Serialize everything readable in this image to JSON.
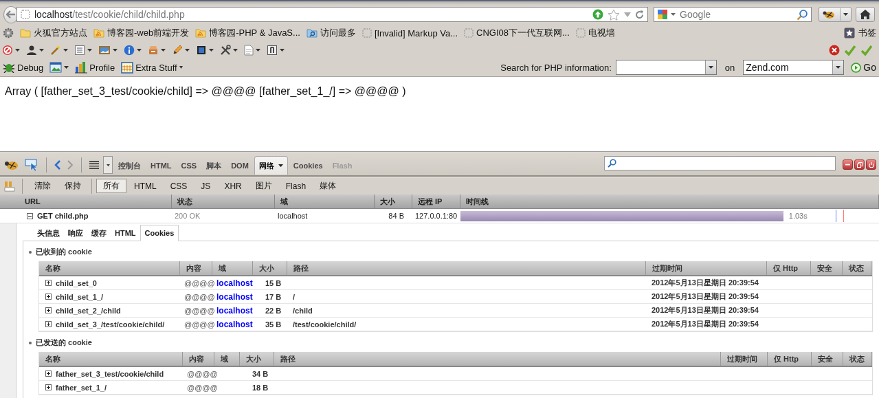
{
  "navbar": {
    "url_host": "localhost",
    "url_path": "/test/cookie/child/child.php",
    "search_placeholder": "Google"
  },
  "bookmarks": [
    {
      "kind": "folder",
      "label": "火狐官方站点"
    },
    {
      "kind": "feed",
      "label": "博客园-web前端开发"
    },
    {
      "kind": "feed",
      "label": "博客园-PHP & JavaS..."
    },
    {
      "kind": "smart",
      "label": "访问最多"
    },
    {
      "kind": "blank",
      "label": "[Invalid] Markup Va..."
    },
    {
      "kind": "blank",
      "label": "CNGI08下一代互联网..."
    },
    {
      "kind": "blank",
      "label": "电视墙"
    }
  ],
  "bookmarks_menu": "书签",
  "firebug_bar": {
    "debug": "Debug",
    "profile": "Profile",
    "extra": "Extra Stuff",
    "search_label": "Search for PHP information:",
    "on": "on",
    "site": "Zend.com",
    "go": "Go"
  },
  "page": {
    "text": "Array ( [father_set_3_test/cookie/child] => @@@@ [father_set_1_/] => @@@@ )"
  },
  "firebug": {
    "tabs": [
      {
        "label": "控制台",
        "selected": false,
        "disabled": false
      },
      {
        "label": "HTML",
        "selected": false,
        "disabled": false
      },
      {
        "label": "CSS",
        "selected": false,
        "disabled": false
      },
      {
        "label": "脚本",
        "selected": false,
        "disabled": false
      },
      {
        "label": "DOM",
        "selected": false,
        "disabled": false
      },
      {
        "label": "网络",
        "selected": true,
        "disabled": false
      },
      {
        "label": "Cookies",
        "selected": false,
        "disabled": false
      },
      {
        "label": "Flash",
        "selected": false,
        "disabled": true
      }
    ],
    "net_commands": [
      "清除",
      "保持"
    ],
    "net_filters": [
      {
        "label": "所有",
        "selected": true
      },
      {
        "label": "HTML",
        "selected": false
      },
      {
        "label": "CSS",
        "selected": false
      },
      {
        "label": "JS",
        "selected": false
      },
      {
        "label": "XHR",
        "selected": false
      },
      {
        "label": "图片",
        "selected": false
      },
      {
        "label": "Flash",
        "selected": false
      },
      {
        "label": "媒体",
        "selected": false
      }
    ],
    "net_columns": [
      "URL",
      "状态",
      "域",
      "大小",
      "远程 IP",
      "时间线"
    ],
    "requests": [
      {
        "request": "GET child.php",
        "status": "200 OK",
        "domain": "localhost",
        "size": "84 B",
        "remote_ip": "127.0.0.1:80",
        "level": 0.87,
        "time": "1.03s",
        "expanded": true
      }
    ],
    "detail_tabs": [
      {
        "label": "头信息",
        "selected": false
      },
      {
        "label": "响应",
        "selected": false
      },
      {
        "label": "缓存",
        "selected": false
      },
      {
        "label": "HTML",
        "selected": false
      },
      {
        "label": "Cookies",
        "selected": true
      }
    ],
    "cookie_sections": [
      {
        "title": "已收到的 cookie",
        "columns": [
          "名称",
          "内容",
          "域",
          "大小",
          "路径",
          "过期时间",
          "仅 Http",
          "安全",
          "状态"
        ],
        "rows": [
          {
            "name": "child_set_0",
            "value": "@@@@",
            "domain": "localhost",
            "size": "15 B",
            "expires": "2012年5月13日星期日 20:39:54",
            "expanded": false
          },
          {
            "name": "child_set_1_/",
            "value": "@@@@",
            "domain": "localhost",
            "size": "17 B",
            "path": "/",
            "expires": "2012年5月13日星期日 20:39:54",
            "expanded": false
          },
          {
            "name": "child_set_2_/child",
            "value": "@@@@",
            "domain": "localhost",
            "size": "22 B",
            "path": "/child",
            "expires": "2012年5月13日星期日 20:39:54",
            "expanded": false
          },
          {
            "name": "child_set_3_/test/cookie/child/",
            "value": "@@@@",
            "domain": "localhost",
            "size": "35 B",
            "path": "/test/cookie/child/",
            "expires": "2012年5月13日星期日 20:39:54",
            "expanded": false
          }
        ]
      },
      {
        "title": "已发送的 cookie",
        "columns": [
          "名称",
          "内容",
          "域",
          "大小",
          "路径",
          "过期时间",
          "仅 Http",
          "安全",
          "状态"
        ],
        "rows": [
          {
            "name": "father_set_3_test/cookie/child",
            "value": "@@@@",
            "size": "34 B",
            "expanded": false
          },
          {
            "name": "father_set_1_/",
            "value": "@@@@",
            "size": "18 B",
            "expanded": false
          }
        ]
      }
    ]
  }
}
